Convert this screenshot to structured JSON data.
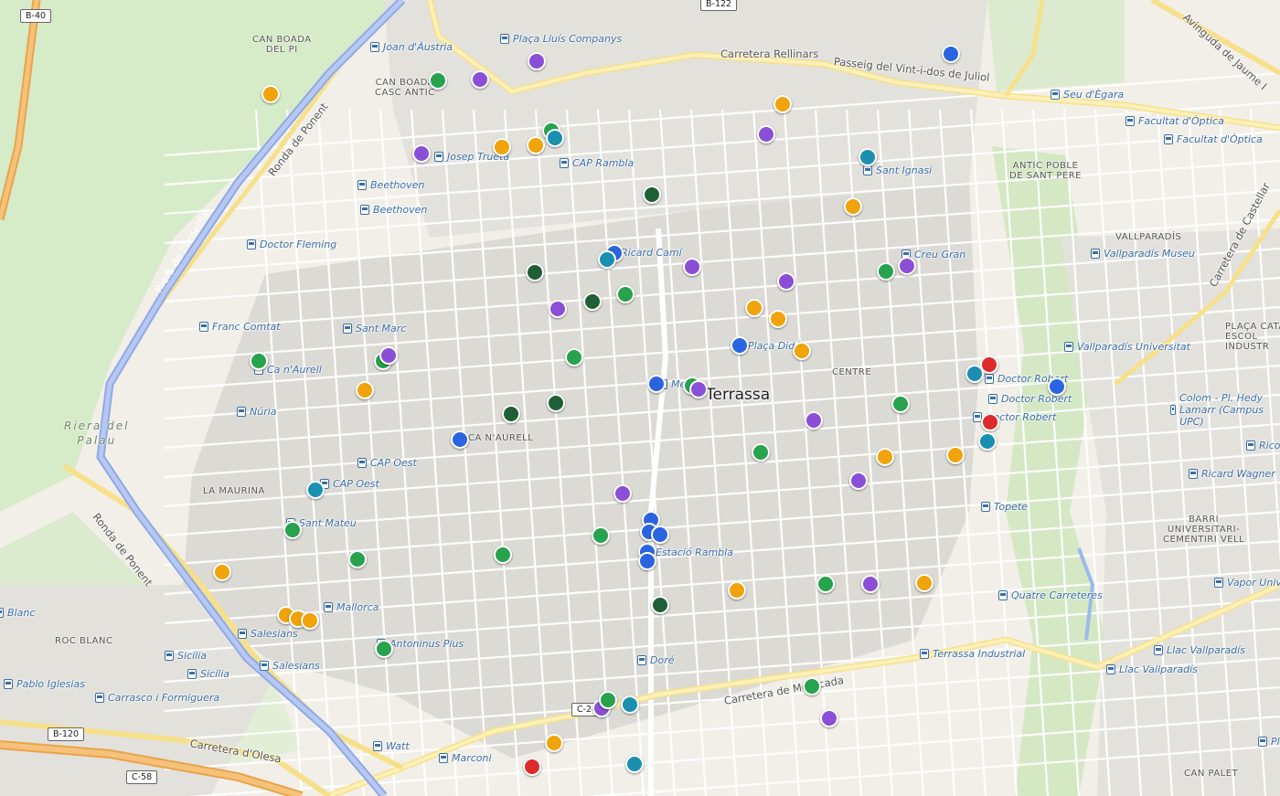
{
  "map": {
    "city_label": "Terrassa",
    "colors": {
      "orange": "#f0a30a",
      "purple": "#8a4fd6",
      "green": "#27a24d",
      "darkgreen": "#1f5f36",
      "teal": "#1a8fb0",
      "blue": "#2b64e0",
      "red": "#dd2a2a"
    },
    "road_shields": [
      "B-40",
      "B-122",
      "B-120",
      "C-58",
      "C-24"
    ],
    "road_labels": [
      "Ronda de Ponent",
      "Riera de l'Ametlla",
      "Passeig del Vint-i-dos de Juliol",
      "Avinguda de Jaume I",
      "Carretera Rellinars",
      "Carretera de Castellar",
      "Carretera de Montcada",
      "Carretera d'Olesa",
      "Ronda de Ponent"
    ],
    "area_labels": [
      "CAN BOADA\nDEL PI",
      "CAN BOADA\nCASC ANTIC",
      "ANTIC POBLE\nDE SANT PERE",
      "VALLPARADÍS",
      "PLAÇA CATA\nESCOL\nINDUSTR",
      "CENTRE",
      "CA N'AURELL",
      "LA MAURINA",
      "ROC BLANC",
      "BARRI\nUNIVERSITARI-\nCEMENTIRI VELL",
      "CAN PALET",
      "Riera del\nPalau"
    ],
    "stop_labels": [
      "Joan d'Àustria",
      "Plaça Lluís Companys",
      "Josep Trueta",
      "CAP Rambla",
      "Beethoven",
      "Beethoven",
      "Doctor Fleming",
      "Ricard Camí",
      "Sant Ignasi",
      "Creu Gran",
      "Franc Comtat",
      "Sant Marc",
      "Ca n'Aurell",
      "Núria",
      "Plaça Didó",
      "Metro",
      "CAP Oest",
      "CAP Oest",
      "Sant Mateu",
      "Estació Rambla",
      "Mallorca",
      "Salesians",
      "Salesians",
      "Antoninus Pius",
      "Sicília",
      "Sicília",
      "Pablo Iglesias",
      "Carrasco i Formiguera",
      "Watt",
      "Marconi",
      "Doré",
      "Terrassa Industrial",
      "Quatre Carreteres",
      "Topete",
      "Doctor Robert",
      "Doctor Robert",
      "Doctor Robert",
      "Seu d'Ègara",
      "Facultat d'Òptica",
      "Facultat d'Òptica",
      "Vallparadís Museu",
      "Vallparadís Universitat",
      "Colom - Pl. Hedy Lamarr (Campus UPC)",
      "Ricard Wagner",
      "Llac Vallparadís",
      "Llac Vallparadís",
      "Vapor Universitari",
      "Rico",
      "Pl.",
      "Blanc"
    ],
    "markers": [
      {
        "color": "orange"
      },
      {
        "color": "green"
      },
      {
        "color": "purple"
      },
      {
        "color": "purple"
      },
      {
        "color": "purple"
      },
      {
        "color": "orange"
      },
      {
        "color": "orange"
      },
      {
        "color": "green"
      },
      {
        "color": "teal"
      },
      {
        "color": "blue"
      },
      {
        "color": "orange"
      },
      {
        "color": "purple"
      },
      {
        "color": "teal"
      },
      {
        "color": "orange"
      },
      {
        "color": "darkgreen"
      },
      {
        "color": "blue"
      },
      {
        "color": "teal"
      },
      {
        "color": "purple"
      },
      {
        "color": "darkgreen"
      },
      {
        "color": "purple"
      },
      {
        "color": "darkgreen"
      },
      {
        "color": "green"
      },
      {
        "color": "purple"
      },
      {
        "color": "orange"
      },
      {
        "color": "orange"
      },
      {
        "color": "green"
      },
      {
        "color": "purple"
      },
      {
        "color": "blue"
      },
      {
        "color": "orange"
      },
      {
        "color": "green"
      },
      {
        "color": "green"
      },
      {
        "color": "purple"
      },
      {
        "color": "orange"
      },
      {
        "color": "green"
      },
      {
        "color": "blue"
      },
      {
        "color": "green"
      },
      {
        "color": "purple"
      },
      {
        "color": "darkgreen"
      },
      {
        "color": "darkgreen"
      },
      {
        "color": "green"
      },
      {
        "color": "red"
      },
      {
        "color": "teal"
      },
      {
        "color": "blue"
      },
      {
        "color": "red"
      },
      {
        "color": "teal"
      },
      {
        "color": "blue"
      },
      {
        "color": "purple"
      },
      {
        "color": "green"
      },
      {
        "color": "orange"
      },
      {
        "color": "orange"
      },
      {
        "color": "purple"
      },
      {
        "color": "teal"
      },
      {
        "color": "purple"
      },
      {
        "color": "blue"
      },
      {
        "color": "blue"
      },
      {
        "color": "blue"
      },
      {
        "color": "blue"
      },
      {
        "color": "blue"
      },
      {
        "color": "green"
      },
      {
        "color": "green"
      },
      {
        "color": "green"
      },
      {
        "color": "orange"
      },
      {
        "color": "orange"
      },
      {
        "color": "orange"
      },
      {
        "color": "orange"
      },
      {
        "color": "green"
      },
      {
        "color": "green"
      },
      {
        "color": "purple"
      },
      {
        "color": "orange"
      },
      {
        "color": "darkgreen"
      },
      {
        "color": "orange"
      },
      {
        "color": "green"
      },
      {
        "color": "purple"
      },
      {
        "color": "green"
      },
      {
        "color": "teal"
      },
      {
        "color": "purple"
      },
      {
        "color": "green"
      },
      {
        "color": "orange"
      },
      {
        "color": "red"
      },
      {
        "color": "teal"
      }
    ]
  }
}
